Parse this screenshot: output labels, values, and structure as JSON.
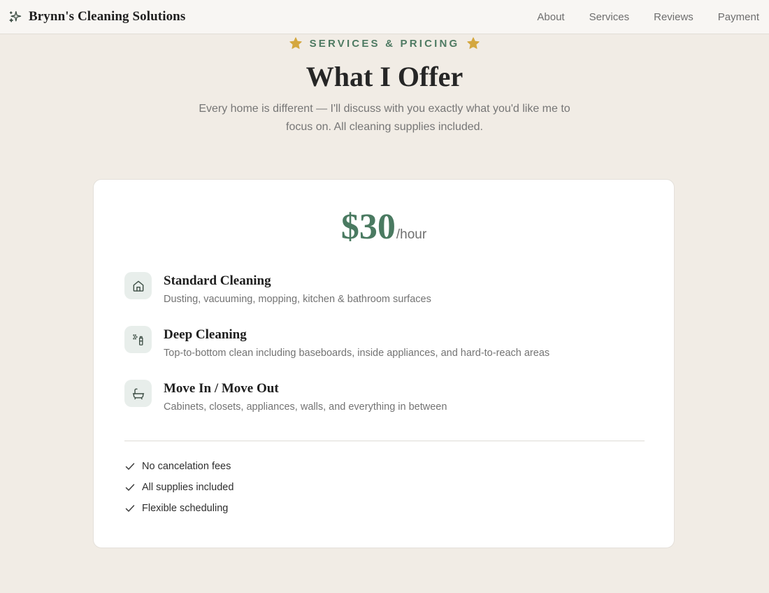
{
  "nav": {
    "brand": "Brynn's Cleaning Solutions",
    "brand_icon": "sparkle-icon",
    "links": [
      "About",
      "Services",
      "Reviews",
      "Payment"
    ]
  },
  "section": {
    "eyebrow": "SERVICES & PRICING",
    "eyebrow_icon": "star-icon",
    "title": "What I Offer",
    "subtitle": "Every home is different — I'll discuss with you exactly what you'd like me to focus on. All cleaning supplies included."
  },
  "pricing": {
    "amount": "$30",
    "unit": "/hour",
    "services": [
      {
        "icon": "house-icon",
        "title": "Standard Cleaning",
        "description": "Dusting, vacuuming, mopping, kitchen & bathroom surfaces"
      },
      {
        "icon": "spray-bottle-icon",
        "title": "Deep Cleaning",
        "description": "Top-to-bottom clean including baseboards, inside appliances, and hard-to-reach areas"
      },
      {
        "icon": "bathtub-icon",
        "title": "Move In / Move Out",
        "description": "Cabinets, closets, appliances, walls, and everything in between"
      }
    ],
    "perks": [
      "No cancelation fees",
      "All supplies included",
      "Flexible scheduling"
    ]
  },
  "colors": {
    "accent_green": "#4a7a61",
    "star_gold": "#d4a73f",
    "page_background": "#f1ece5",
    "card_background": "#ffffff"
  }
}
